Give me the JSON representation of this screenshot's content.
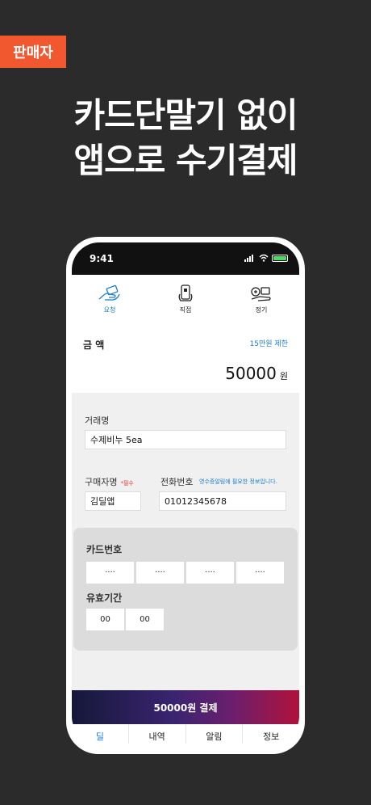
{
  "badge": "판매자",
  "headline": {
    "line1": "카드단말기 없이",
    "line2": "앱으로 수기결제"
  },
  "status": {
    "time": "9:41"
  },
  "top_tabs": [
    {
      "label": "요청",
      "icon": "hand-card-icon",
      "active": true
    },
    {
      "label": "직접",
      "icon": "phone-hand-icon",
      "active": false
    },
    {
      "label": "정기",
      "icon": "recurring-payment-icon",
      "active": false
    }
  ],
  "amount": {
    "label": "금 액",
    "limit": "15만원 제한",
    "value": "50000",
    "unit": "원"
  },
  "form": {
    "deal_name_label": "거래명",
    "deal_name_value": "수제비누 5ea",
    "buyer_label": "구매자명",
    "buyer_required": "*필수",
    "buyer_value": "김딜앱",
    "phone_label": "전화번호",
    "phone_note": "영수증알림에 필요한 정보입니다.",
    "phone_value": "01012345678"
  },
  "card": {
    "number_label": "카드번호",
    "number_parts": [
      "····",
      "····",
      "····",
      "····"
    ],
    "expiry_label": "유효기간",
    "expiry_month": "00",
    "expiry_year": "00"
  },
  "pay_button": "50000원 결제",
  "bottom_nav": [
    "딜",
    "내역",
    "알림",
    "정보"
  ],
  "colors": {
    "accent": "#1a7fd0",
    "badge": "#f1582f",
    "background": "#2b2b2b"
  }
}
